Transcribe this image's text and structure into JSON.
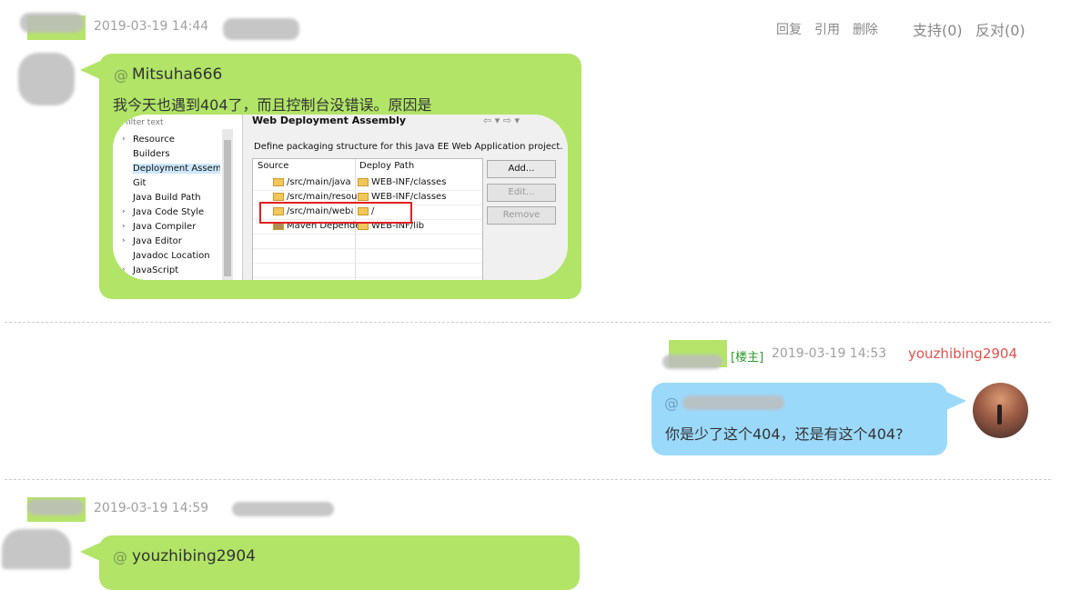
{
  "comment1": {
    "timestamp": "2019-03-19 14:44",
    "actions": [
      "回复",
      "引用",
      "删除"
    ],
    "support": "支持(0)",
    "oppose": "反对(0)",
    "at_symbol": "@",
    "reply_to": "Mitsuha666",
    "message": "我今天也遇到404了，而且控制台没错误。原因是",
    "screenshot": {
      "filter_placeholder": "filter text",
      "tree": [
        "Resource",
        "Builders",
        "Deployment Assembly",
        "Git",
        "Java Build Path",
        "Java Code Style",
        "Java Compiler",
        "Java Editor",
        "Javadoc Location",
        "JavaScript"
      ],
      "panel_title": "Web Deployment Assembly",
      "description": "Define packaging structure for this Java EE Web Application project.",
      "col_source": "Source",
      "col_deploy": "Deploy Path",
      "rows": [
        {
          "source": "/src/main/java",
          "deploy": "WEB-INF/classes"
        },
        {
          "source": "/src/main/resou",
          "deploy": "WEB-INF/classes"
        },
        {
          "source": "/src/main/webap",
          "deploy": "/"
        },
        {
          "source": "Maven Depende",
          "deploy": "WEB-INF/lib"
        }
      ],
      "btn_add": "Add...",
      "btn_edit": "Edit...",
      "btn_remove": "Remove"
    }
  },
  "comment2": {
    "owner_tag": "[楼主]",
    "timestamp": "2019-03-19 14:53",
    "author": "youzhibing2904",
    "at_symbol": "@",
    "message": "你是少了这个404，还是有这个404?"
  },
  "comment3": {
    "timestamp": "2019-03-19 14:59",
    "at_symbol": "@",
    "reply_to": "youzhibing2904"
  },
  "colors": {
    "green_bubble": "#b1e467",
    "blue_bubble": "#9bd9fb",
    "owner_red": "#e0504d",
    "owner_tag_green": "#2e9b2e"
  }
}
